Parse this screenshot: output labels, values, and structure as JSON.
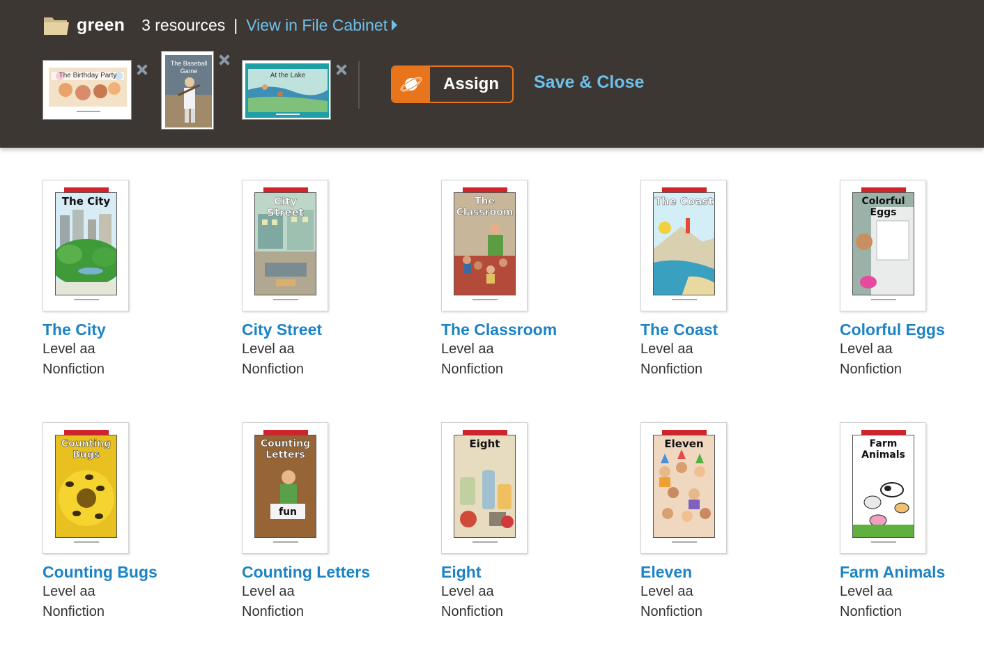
{
  "header": {
    "folder_name": "green",
    "resource_count": "3 resources",
    "separator": "|",
    "view_link": "View in File Cabinet",
    "assign_label": "Assign",
    "save_close_label": "Save & Close",
    "selected": [
      {
        "title": "The Birthday Party"
      },
      {
        "title": "The Baseball Game"
      },
      {
        "title": "At the Lake"
      }
    ]
  },
  "books": [
    {
      "title": "The City",
      "cover_text": "The City",
      "level": "Level aa",
      "genre": "Nonfiction"
    },
    {
      "title": "City Street",
      "cover_text": "City Street",
      "level": "Level aa",
      "genre": "Nonfiction"
    },
    {
      "title": "The Classroom",
      "cover_text": "The Classroom",
      "level": "Level aa",
      "genre": "Nonfiction"
    },
    {
      "title": "The Coast",
      "cover_text": "The Coast",
      "level": "Level aa",
      "genre": "Nonfiction"
    },
    {
      "title": "Colorful Eggs",
      "cover_text": "Colorful Eggs",
      "level": "Level aa",
      "genre": "Nonfiction"
    },
    {
      "title": "Counting Bugs",
      "cover_text": "Counting Bugs",
      "level": "Level aa",
      "genre": "Nonfiction"
    },
    {
      "title": "Counting Letters",
      "cover_text": "Counting Letters",
      "level": "Level aa",
      "genre": "Nonfiction"
    },
    {
      "title": "Eight",
      "cover_text": "Eight",
      "level": "Level aa",
      "genre": "Nonfiction"
    },
    {
      "title": "Eleven",
      "cover_text": "Eleven",
      "level": "Level aa",
      "genre": "Nonfiction"
    },
    {
      "title": "Farm Animals",
      "cover_text": "Farm Animals",
      "level": "Level aa",
      "genre": "Nonfiction"
    }
  ],
  "colors": {
    "header_bg": "#3d3734",
    "link": "#6ec0ea",
    "title": "#1c83c5",
    "assign": "#e8741c"
  }
}
